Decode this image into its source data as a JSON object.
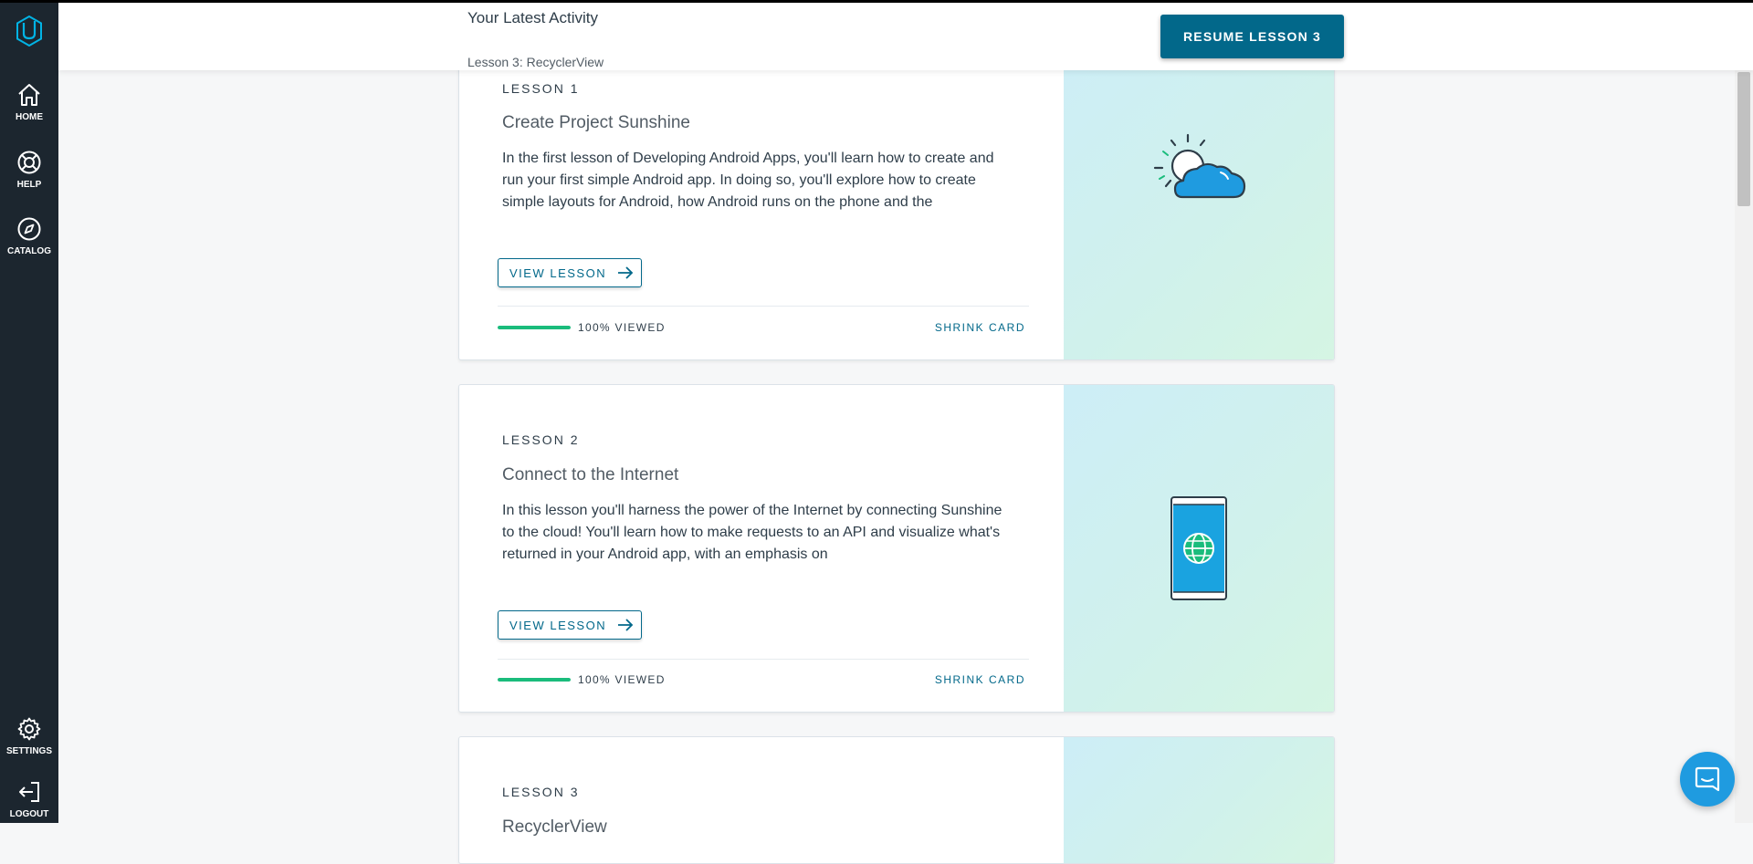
{
  "sidebar": {
    "logo_icon": "udacity-logo-icon",
    "items": [
      {
        "label": "HOME",
        "icon": "home-icon"
      },
      {
        "label": "HELP",
        "icon": "lifebuoy-icon"
      },
      {
        "label": "CATALOG",
        "icon": "compass-icon"
      },
      {
        "label": "SETTINGS",
        "icon": "gear-icon"
      },
      {
        "label": "LOGOUT",
        "icon": "logout-icon"
      }
    ]
  },
  "header": {
    "title": "Your Latest Activity",
    "subtitle": "Lesson 3: RecyclerView",
    "resume_label": "RESUME LESSON 3"
  },
  "lessons": [
    {
      "label": "LESSON 1",
      "title": "Create Project Sunshine",
      "description": "In the first lesson of Developing Android Apps, you'll learn how to create and run your first simple Android app. In doing so, you'll explore how to create simple layouts for Android, how Android runs on the phone and the",
      "view_label": "VIEW LESSON",
      "progress_percent": 100,
      "progress_label": "100% VIEWED",
      "shrink_label": "SHRINK CARD",
      "illustration": "sun-cloud-icon"
    },
    {
      "label": "LESSON 2",
      "title": "Connect to the Internet",
      "description": "In this lesson you'll harness the power of the Internet by connecting Sunshine to the cloud! You'll learn how to make requests to an API and visualize what's returned in your Android app, with an emphasis on",
      "view_label": "VIEW LESSON",
      "progress_percent": 100,
      "progress_label": "100% VIEWED",
      "shrink_label": "SHRINK CARD",
      "illustration": "phone-globe-icon"
    },
    {
      "label": "LESSON 3",
      "title": "RecyclerView"
    }
  ],
  "colors": {
    "accent": "#02688a",
    "progress": "#1abc7c",
    "sidebar": "#1c262f",
    "chat": "#1f9be0"
  },
  "chat": {
    "icon": "chat-icon"
  }
}
